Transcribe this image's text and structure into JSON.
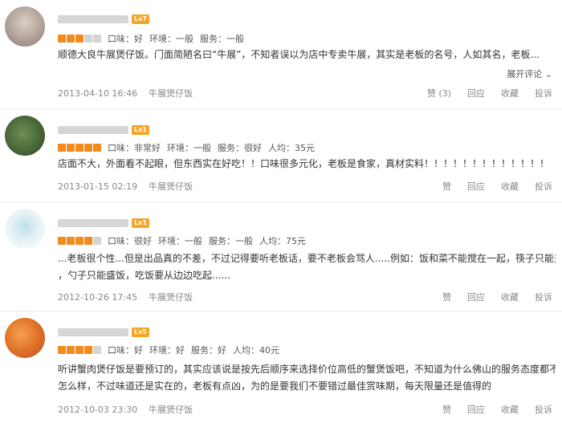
{
  "reviews": [
    {
      "level": "Lv7",
      "stars": 3,
      "ratings": [
        "口味：好",
        "环境：一般",
        "服务：一般"
      ],
      "text_lines": [
        "顺德大良牛展煲仔饭。门面简陋名曰“牛展”，不知者误以为店中专卖牛展，其实是老板的名号，人如其名，老板..."
      ],
      "expand": "展开评论 ⌄",
      "date": "2013-04-10 16:46",
      "shop": "牛展煲仔饭",
      "actions": [
        "赞 (3)",
        "回应",
        "收藏",
        "投诉"
      ]
    },
    {
      "level": "Lv1",
      "stars": 5,
      "ratings": [
        "口味：非常好",
        "环境：一般",
        "服务：很好",
        "人均：35元"
      ],
      "text_lines": [
        "店面不大，外面看不起眼，但东西实在好吃！！口味很多元化，老板是食家，真材实料！！！！！！！！！！！！！"
      ],
      "date": "2013-01-15 02:19",
      "shop": "牛展煲仔饭",
      "actions": [
        "赞",
        "回应",
        "收藏",
        "投诉"
      ]
    },
    {
      "level": "Lv1",
      "stars": 4,
      "ratings": [
        "口味：很好",
        "环境：一般",
        "服务：一般",
        "人均：75元"
      ],
      "text_lines": [
        "...老板很个性...但是出品真的不差，不过记得要听老板话，要不老板会骂人.....例如：饭和菜不能搅在一起，筷子只能夹菜",
        "，勺子只能盛饭，吃饭要从边边吃起......"
      ],
      "date": "2012-10-26 17:45",
      "shop": "牛展煲仔饭",
      "actions": [
        "赞",
        "回应",
        "收藏",
        "投诉"
      ]
    },
    {
      "level": "Lv5",
      "stars": 4,
      "ratings": [
        "口味：好",
        "环境：好",
        "服务：好",
        "人均：40元"
      ],
      "text_lines": [
        "听讲蟹肉煲仔饭是要预订的，其实应该说是按先后顺序来选择价位高低的蟹煲饭吧，不知道为什么佛山的服务态度都不",
        "怎么样，不过味道还是实在的，老板有点凶，为的是要我们不要错过最佳赏味期，每天限量还是值得的"
      ],
      "date": "2012-10-03 23:30",
      "shop": "牛展煲仔饭",
      "actions": [
        "赞",
        "回应",
        "收藏",
        "投诉"
      ]
    }
  ]
}
